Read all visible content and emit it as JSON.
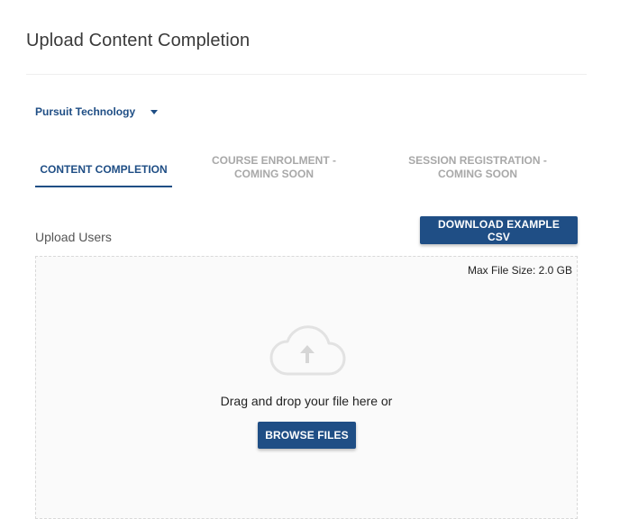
{
  "page": {
    "title": "Upload Content Completion"
  },
  "org_selector": {
    "selected": "Pursuit Technology",
    "icon": "caret-down-icon"
  },
  "tabs": [
    {
      "label": "CONTENT COMPLETION",
      "active": true,
      "enabled": true
    },
    {
      "label": "COURSE ENROLMENT - COMING SOON",
      "active": false,
      "enabled": false
    },
    {
      "label": "SESSION REGISTRATION - COMING SOON",
      "active": false,
      "enabled": false
    }
  ],
  "upload": {
    "section_label": "Upload Users",
    "download_button": "DOWNLOAD EXAMPLE CSV",
    "max_file_size": "Max File Size: 2.0 GB",
    "drop_text": "Drag and drop your file here or",
    "browse_button": "BROWSE FILES",
    "icon": "cloud-upload-icon"
  },
  "colors": {
    "primary": "#1f4e85",
    "disabled_text": "#a8a8a8",
    "dropzone_bg": "#fafafa",
    "dropzone_border": "#d9d9d9"
  }
}
